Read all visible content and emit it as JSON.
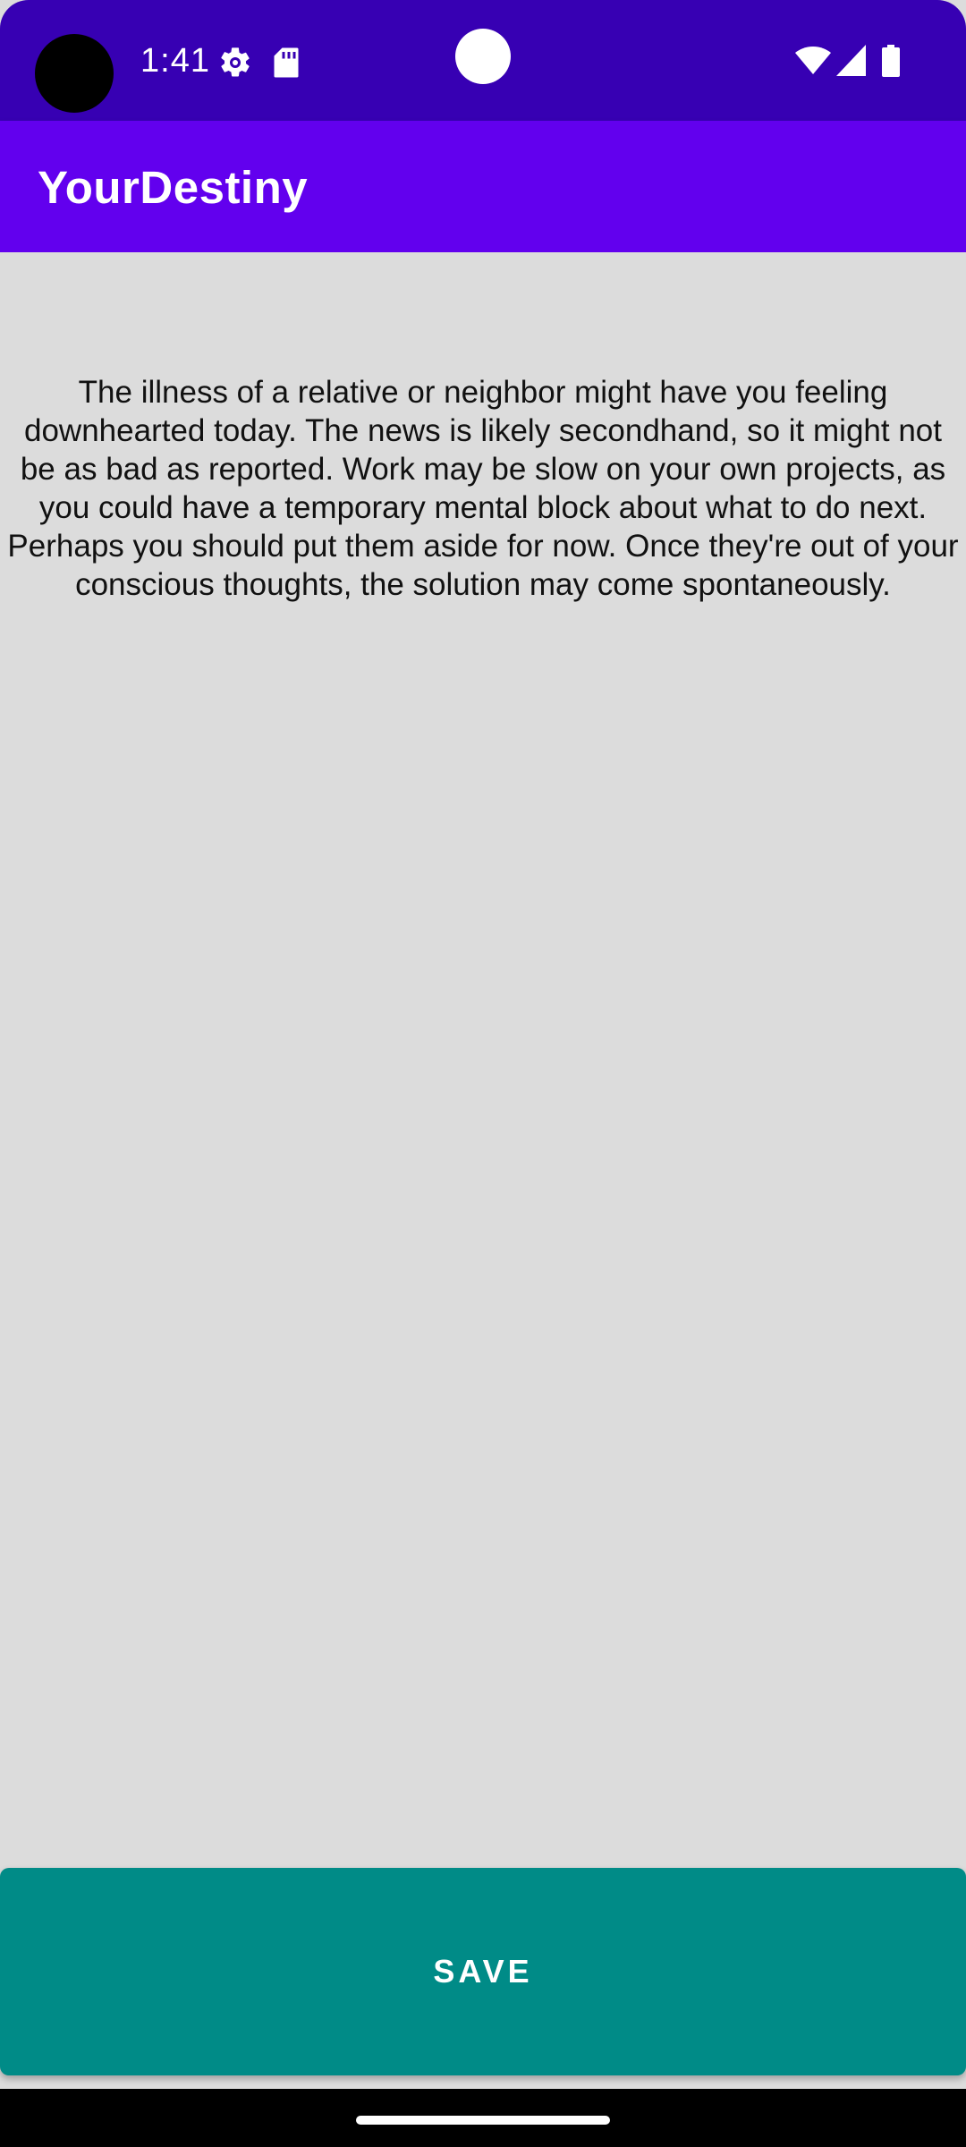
{
  "status_bar": {
    "time": "1:41",
    "icons": [
      "camera-cutout",
      "settings-icon",
      "sd-card-icon",
      "front-sensor",
      "wifi-icon",
      "cellular-signal-icon",
      "battery-icon"
    ]
  },
  "app_bar": {
    "title": "YourDestiny"
  },
  "content": {
    "horoscope_text": "The illness of a relative or neighbor might have you feeling downhearted today. The news is likely secondhand, so it might not be as bad as reported. Work may be slow on your own projects, as you could have a temporary mental block about what to do next. Perhaps you should put them aside for now. Once they're out of your conscious thoughts, the solution may come spontaneously."
  },
  "actions": {
    "save_label": "SAVE"
  },
  "colors": {
    "status_bar": "#3700b3",
    "app_bar": "#6200ee",
    "background": "#dcdcdc",
    "save_button": "#008b87",
    "navigation_bar": "#000000"
  }
}
